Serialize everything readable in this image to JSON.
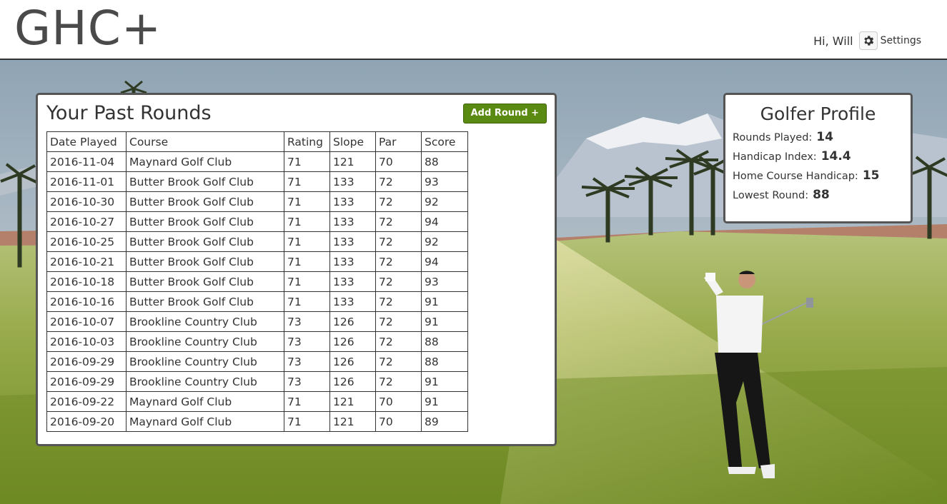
{
  "app": {
    "logo": "GHC+"
  },
  "header": {
    "greeting": "Hi, Will",
    "settings_label": "Settings",
    "settings_icon": "gear-icon"
  },
  "rounds": {
    "title": "Your Past Rounds",
    "add_button_label": "Add Round +",
    "add_button_color": "#5b8a12",
    "columns": [
      "Date Played",
      "Course",
      "Rating",
      "Slope",
      "Par",
      "Score"
    ],
    "rows": [
      [
        "2016-11-04",
        "Maynard Golf Club",
        "71",
        "121",
        "70",
        "88"
      ],
      [
        "2016-11-01",
        "Butter Brook Golf Club",
        "71",
        "133",
        "72",
        "93"
      ],
      [
        "2016-10-30",
        "Butter Brook Golf Club",
        "71",
        "133",
        "72",
        "92"
      ],
      [
        "2016-10-27",
        "Butter Brook Golf Club",
        "71",
        "133",
        "72",
        "94"
      ],
      [
        "2016-10-25",
        "Butter Brook Golf Club",
        "71",
        "133",
        "72",
        "92"
      ],
      [
        "2016-10-21",
        "Butter Brook Golf Club",
        "71",
        "133",
        "72",
        "94"
      ],
      [
        "2016-10-18",
        "Butter Brook Golf Club",
        "71",
        "133",
        "72",
        "93"
      ],
      [
        "2016-10-16",
        "Butter Brook Golf Club",
        "71",
        "133",
        "72",
        "91"
      ],
      [
        "2016-10-07",
        "Brookline Country Club",
        "73",
        "126",
        "72",
        "91"
      ],
      [
        "2016-10-03",
        "Brookline Country Club",
        "73",
        "126",
        "72",
        "88"
      ],
      [
        "2016-09-29",
        "Brookline Country Club",
        "73",
        "126",
        "72",
        "88"
      ],
      [
        "2016-09-29",
        "Brookline Country Club",
        "73",
        "126",
        "72",
        "91"
      ],
      [
        "2016-09-22",
        "Maynard Golf Club",
        "71",
        "121",
        "70",
        "91"
      ],
      [
        "2016-09-20",
        "Maynard Golf Club",
        "71",
        "121",
        "70",
        "89"
      ]
    ]
  },
  "profile": {
    "title": "Golfer Profile",
    "stats": [
      {
        "label": "Rounds Played:",
        "value": "14"
      },
      {
        "label": "Handicap Index:",
        "value": "14.4"
      },
      {
        "label": "Home Course Handicap:",
        "value": "15"
      },
      {
        "label": "Lowest Round:",
        "value": "88"
      }
    ]
  }
}
